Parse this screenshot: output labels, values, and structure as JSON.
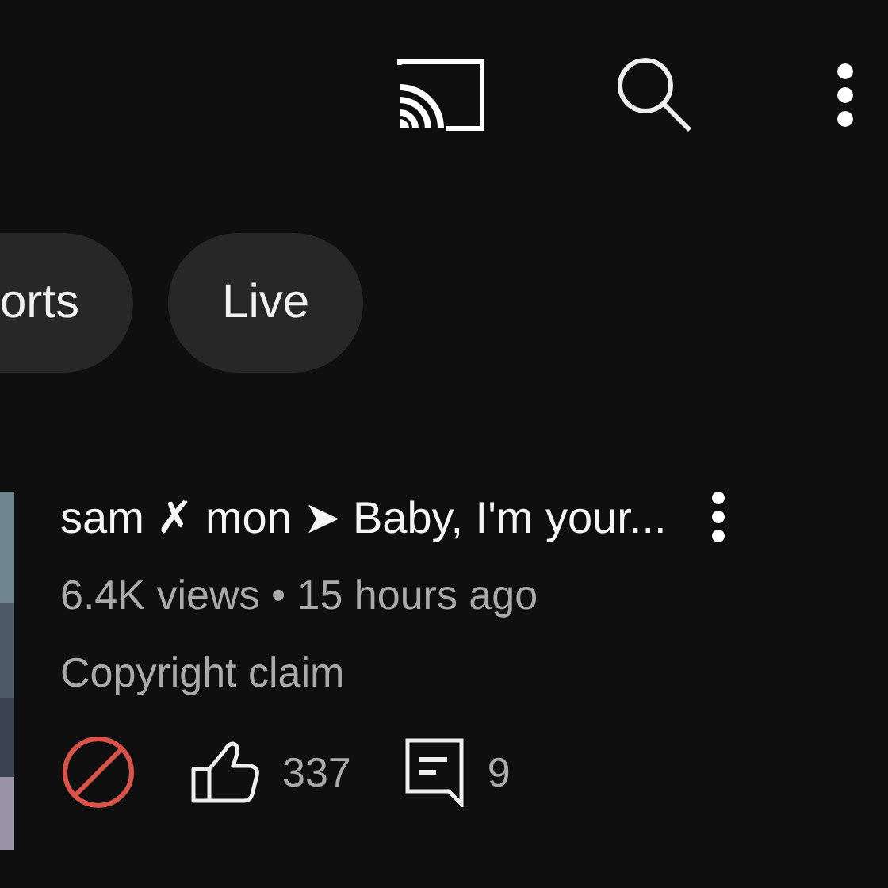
{
  "chips": [
    {
      "label": "orts",
      "cut_left": true
    },
    {
      "label": "Live",
      "cut_left": false
    }
  ],
  "video": {
    "title": "sam ✗ mon ➤ Baby, I'm your...",
    "meta": "6.4K views • 15 hours ago",
    "status": "Copyright claim",
    "likes": "337",
    "comments": "9"
  }
}
